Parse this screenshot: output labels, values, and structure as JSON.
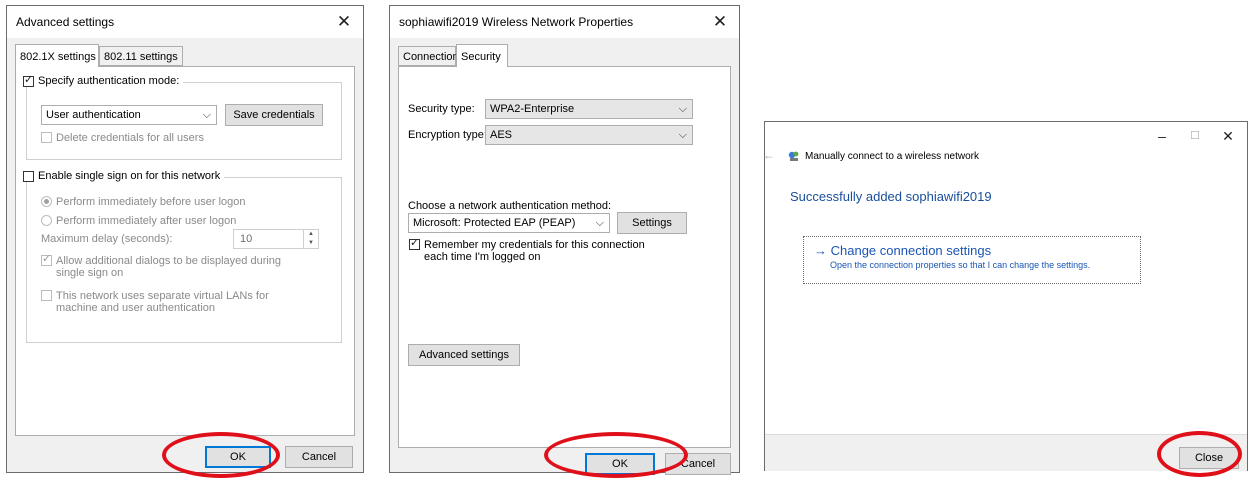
{
  "advanced": {
    "title": "Advanced settings",
    "tabs": [
      "802.1X settings",
      "802.11 settings"
    ],
    "specify_label": "Specify authentication mode:",
    "auth_mode": "User authentication",
    "save_credentials": "Save credentials",
    "delete_credentials": "Delete credentials for all users",
    "sso_label": "Enable single sign on for this network",
    "radio1": "Perform immediately before user logon",
    "radio2": "Perform immediately after user logon",
    "max_delay_label": "Maximum delay (seconds):",
    "max_delay_value": "10",
    "allow_dialogs": "Allow additional dialogs to be displayed during single sign on",
    "vlan": "This network uses separate virtual LANs for machine and user authentication",
    "ok": "OK",
    "cancel": "Cancel"
  },
  "props": {
    "title": "sophiawifi2019 Wireless Network Properties",
    "tabs": [
      "Connection",
      "Security"
    ],
    "security_type_label": "Security type:",
    "security_type": "WPA2-Enterprise",
    "encryption_type_label": "Encryption type:",
    "encryption_type": "AES",
    "method_label": "Choose a network authentication method:",
    "method": "Microsoft: Protected EAP (PEAP)",
    "settings": "Settings",
    "remember": "Remember my credentials for this connection each time I'm logged on",
    "advanced_settings": "Advanced settings",
    "ok": "OK",
    "cancel": "Cancel"
  },
  "wizard": {
    "title": "Manually connect to a wireless network",
    "heading": "Successfully added sophiawifi2019",
    "link_arrow": "→",
    "link_main": "Change connection settings",
    "link_sub": "Open the connection properties so that I can change the settings.",
    "close": "Close"
  },
  "glyphs": {
    "close": "✕",
    "check": "✓",
    "chevron": "⌵",
    "minimize": "–",
    "maximize": "☐",
    "back": "←",
    "up": "▲",
    "down": "▼"
  },
  "colors": {
    "highlight": "#e0101a",
    "link": "#1a55b5",
    "accent": "#0078d7"
  }
}
